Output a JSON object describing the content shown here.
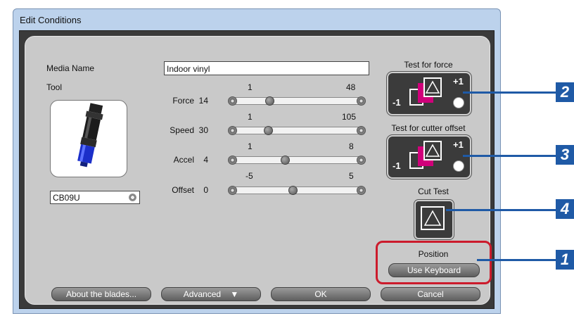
{
  "window": {
    "title": "Edit Conditions"
  },
  "media": {
    "label": "Media Name",
    "value": "Indoor vinyl"
  },
  "tool": {
    "label": "Tool",
    "selected": "CB09U"
  },
  "sliders": [
    {
      "name": "Force",
      "value": "14",
      "min": "1",
      "max": "48",
      "position": 0.29
    },
    {
      "name": "Speed",
      "value": "30",
      "min": "1",
      "max": "105",
      "position": 0.28
    },
    {
      "name": "Accel",
      "value": "4",
      "min": "1",
      "max": "8",
      "position": 0.43
    },
    {
      "name": "Offset",
      "value": "0",
      "min": "-5",
      "max": "5",
      "position": 0.5
    }
  ],
  "test_force": {
    "label": "Test for force",
    "minus": "-1",
    "plus": "+1"
  },
  "test_offset": {
    "label": "Test for cutter offset",
    "minus": "-1",
    "plus": "+1"
  },
  "cut_test": {
    "label": "Cut Test"
  },
  "position": {
    "label": "Position",
    "button": "Use Keyboard"
  },
  "footer": {
    "about": "About the blades...",
    "advanced": "Advanced",
    "advanced_arrow": "▼",
    "ok": "OK",
    "cancel": "Cancel"
  },
  "callouts": [
    "2",
    "3",
    "4",
    "1"
  ],
  "colors": {
    "accent_callout": "#1f5aa6",
    "highlight": "#cc1b2c",
    "magenta": "#d0007a"
  }
}
